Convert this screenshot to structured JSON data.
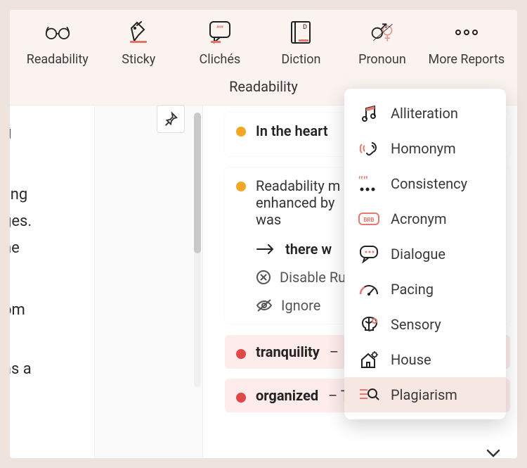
{
  "toolbar": {
    "items": [
      {
        "label": "Readability"
      },
      {
        "label": "Sticky"
      },
      {
        "label": "Clichés"
      },
      {
        "label": "Diction"
      },
      {
        "label": "Pronoun"
      },
      {
        "label": "More Reports"
      }
    ]
  },
  "subheading": "Readability",
  "left_fragments": [
    "g",
    "ling",
    "ges.",
    "ne",
    "om",
    "as a"
  ],
  "cards": {
    "c1": {
      "title": "In the heart"
    },
    "c2": {
      "line1": "Readability m",
      "line2": "enhanced by",
      "line3": "was",
      "suggestion": "there w",
      "disable": "Disable Ru",
      "ignore": "Ignore"
    },
    "pill1": {
      "word": "tranquility",
      "dash": "–"
    },
    "pill2": {
      "word": "organized",
      "rest": "– This is the US s"
    }
  },
  "dropdown": {
    "items": [
      {
        "label": "Alliteration"
      },
      {
        "label": "Homonym"
      },
      {
        "label": "Consistency"
      },
      {
        "label": "Acronym"
      },
      {
        "label": "Dialogue"
      },
      {
        "label": "Pacing"
      },
      {
        "label": "Sensory"
      },
      {
        "label": "House"
      },
      {
        "label": "Plagiarism"
      }
    ]
  }
}
